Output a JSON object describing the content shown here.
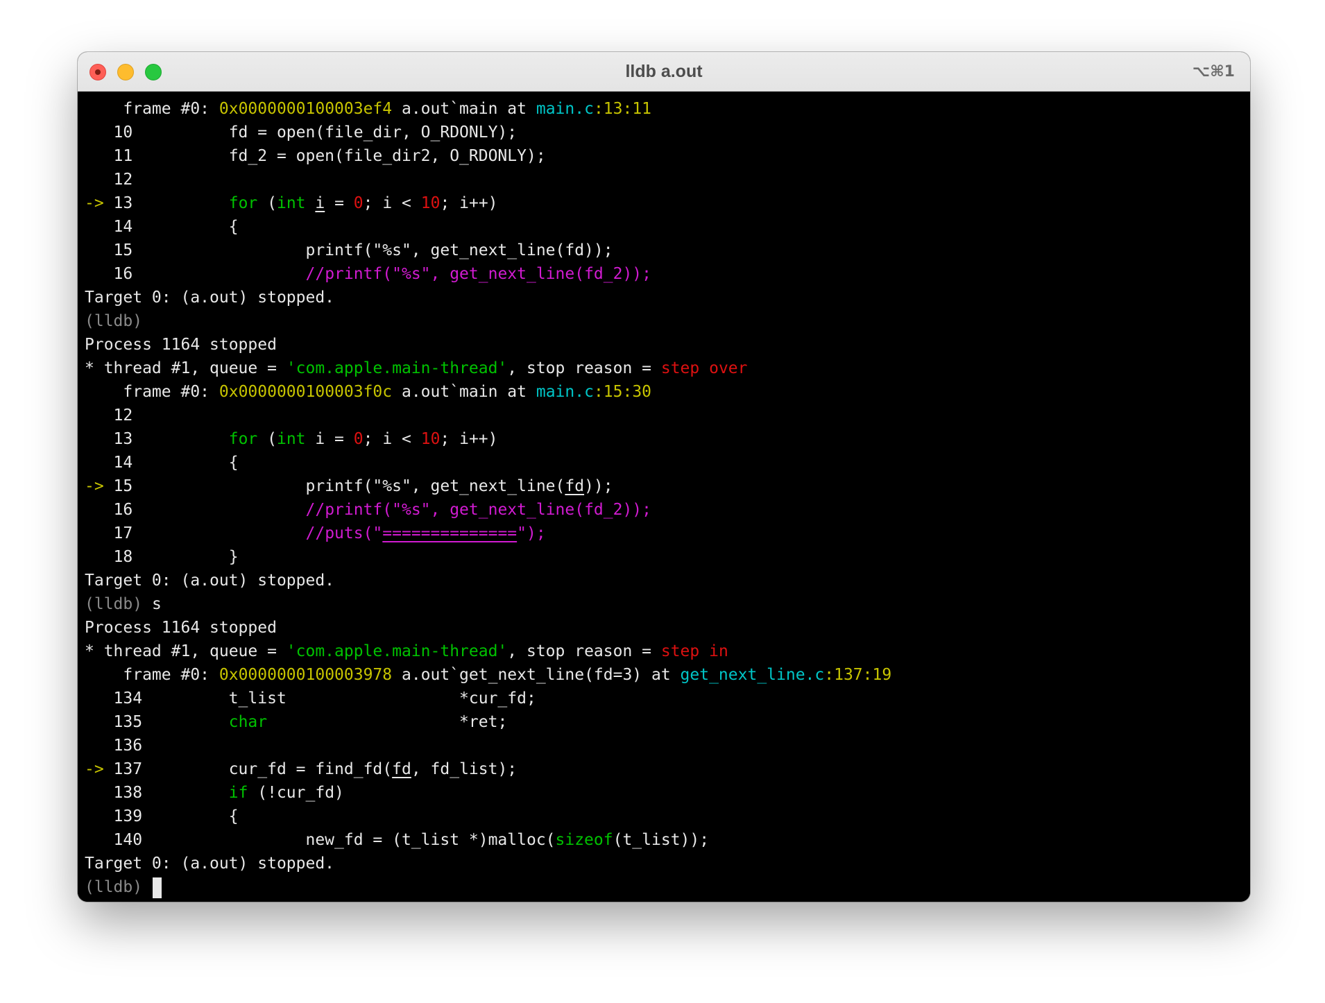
{
  "window": {
    "title": "lldb a.out",
    "shortcut": "⌥⌘1"
  },
  "terminal": {
    "lines": [
      [
        [
          "    frame #0: ",
          "default"
        ],
        [
          "0x0000000100003ef4",
          "yellow"
        ],
        [
          " a.out`main at ",
          "default"
        ],
        [
          "main.c",
          "cyan"
        ],
        [
          ":13:11",
          "yellow"
        ]
      ],
      [
        [
          "   10          fd = open(file_dir, O_RDONLY);",
          "default"
        ]
      ],
      [
        [
          "   11          fd_2 = open(file_dir2, O_RDONLY);",
          "default"
        ]
      ],
      [
        [
          "   12",
          "default"
        ]
      ],
      [
        [
          "-> ",
          "yellow"
        ],
        [
          "13          ",
          "default"
        ],
        [
          "for",
          "green"
        ],
        [
          " (",
          "default"
        ],
        [
          "int",
          "green"
        ],
        [
          " ",
          "default"
        ],
        [
          "i",
          "underline"
        ],
        [
          " = ",
          "default"
        ],
        [
          "0",
          "red"
        ],
        [
          "; i < ",
          "default"
        ],
        [
          "10",
          "red"
        ],
        [
          "; i++)",
          "default"
        ]
      ],
      [
        [
          "   14          {",
          "default"
        ]
      ],
      [
        [
          "   15                  printf(\"%s\", get_next_line(fd));",
          "default"
        ]
      ],
      [
        [
          "   16                  ",
          "default"
        ],
        [
          "//printf(\"%s\", get_next_line(fd_2));",
          "magenta"
        ]
      ],
      [
        [
          "Target 0: (a.out) stopped.",
          "default"
        ]
      ],
      [
        [
          "(lldb)",
          "gray"
        ]
      ],
      [
        [
          "Process 1164 stopped",
          "default"
        ]
      ],
      [
        [
          "* thread #1, queue = ",
          "default"
        ],
        [
          "'com.apple.main-thread'",
          "green"
        ],
        [
          ", stop reason = ",
          "default"
        ],
        [
          "step over",
          "red"
        ]
      ],
      [
        [
          "    frame #0: ",
          "default"
        ],
        [
          "0x0000000100003f0c",
          "yellow"
        ],
        [
          " a.out`main at ",
          "default"
        ],
        [
          "main.c",
          "cyan"
        ],
        [
          ":15:30",
          "yellow"
        ]
      ],
      [
        [
          "   12",
          "default"
        ]
      ],
      [
        [
          "   13          ",
          "default"
        ],
        [
          "for",
          "green"
        ],
        [
          " (",
          "default"
        ],
        [
          "int",
          "green"
        ],
        [
          " i = ",
          "default"
        ],
        [
          "0",
          "red"
        ],
        [
          "; i < ",
          "default"
        ],
        [
          "10",
          "red"
        ],
        [
          "; i++)",
          "default"
        ]
      ],
      [
        [
          "   14          {",
          "default"
        ]
      ],
      [
        [
          "-> ",
          "yellow"
        ],
        [
          "15                  printf(\"%s\", get_next_line(",
          "default"
        ],
        [
          "fd",
          "underline"
        ],
        [
          "));",
          "default"
        ]
      ],
      [
        [
          "   16                  ",
          "default"
        ],
        [
          "//printf(\"%s\", get_next_line(fd_2));",
          "magenta"
        ]
      ],
      [
        [
          "   17                  ",
          "default"
        ],
        [
          "//puts(\"",
          "magenta"
        ],
        [
          "==============",
          "magenta-underline"
        ],
        [
          "\");",
          "magenta"
        ]
      ],
      [
        [
          "   18          }",
          "default"
        ]
      ],
      [
        [
          "Target 0: (a.out) stopped.",
          "default"
        ]
      ],
      [
        [
          "(lldb)",
          "gray"
        ],
        [
          " s",
          "default"
        ]
      ],
      [
        [
          "Process 1164 stopped",
          "default"
        ]
      ],
      [
        [
          "* thread #1, queue = ",
          "default"
        ],
        [
          "'com.apple.main-thread'",
          "green"
        ],
        [
          ", stop reason = ",
          "default"
        ],
        [
          "step in",
          "red"
        ]
      ],
      [
        [
          "    frame #0: ",
          "default"
        ],
        [
          "0x0000000100003978",
          "yellow"
        ],
        [
          " a.out`get_next_line(fd=3) at ",
          "default"
        ],
        [
          "get_next_line.c",
          "cyan"
        ],
        [
          ":137:19",
          "yellow"
        ]
      ],
      [
        [
          "   134         t_list                  *cur_fd;",
          "default"
        ]
      ],
      [
        [
          "   135         ",
          "default"
        ],
        [
          "char",
          "green"
        ],
        [
          "                    *ret;",
          "default"
        ]
      ],
      [
        [
          "   136",
          "default"
        ]
      ],
      [
        [
          "-> ",
          "yellow"
        ],
        [
          "137         cur_fd = find_fd(",
          "default"
        ],
        [
          "fd",
          "underline"
        ],
        [
          ", fd_list);",
          "default"
        ]
      ],
      [
        [
          "   138         ",
          "default"
        ],
        [
          "if",
          "green"
        ],
        [
          " (!cur_fd)",
          "default"
        ]
      ],
      [
        [
          "   139         {",
          "default"
        ]
      ],
      [
        [
          "   140                 new_fd = (t_list *)malloc(",
          "default"
        ],
        [
          "sizeof",
          "green"
        ],
        [
          "(t_list));",
          "default"
        ]
      ],
      [
        [
          "Target 0: (a.out) stopped.",
          "default"
        ]
      ],
      [
        [
          "(lldb) ",
          "gray"
        ]
      ]
    ]
  }
}
